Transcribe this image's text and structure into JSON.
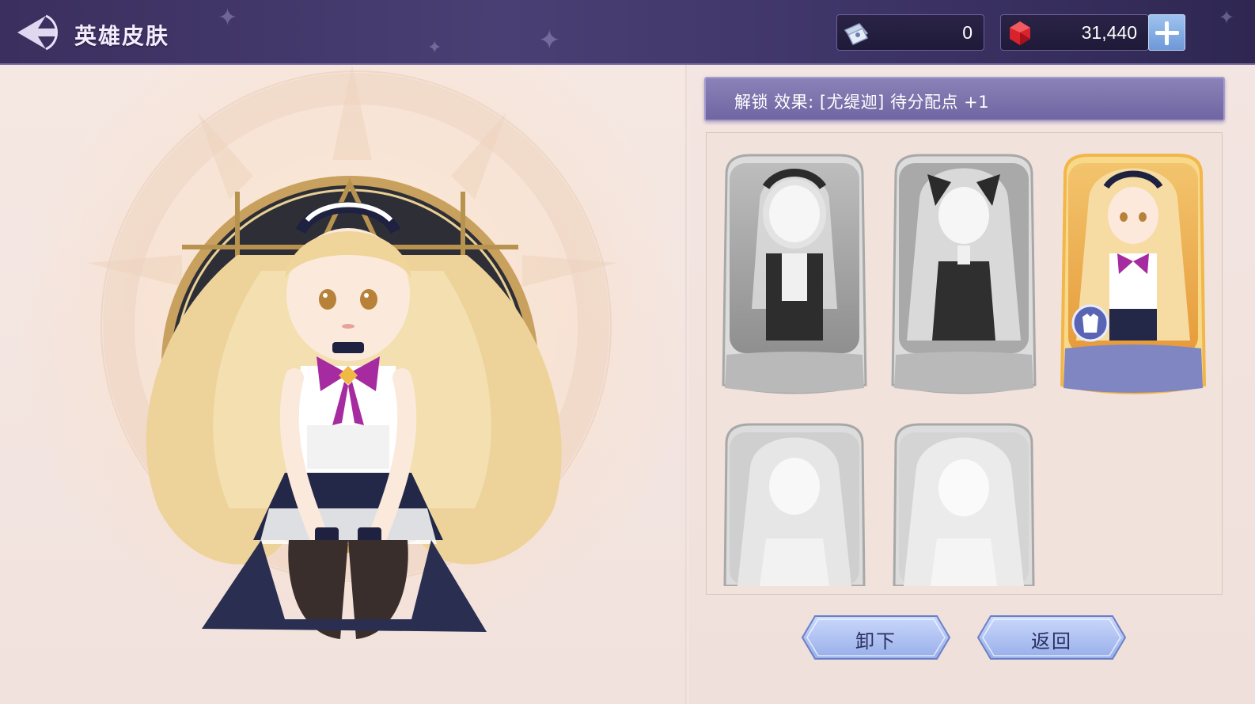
{
  "header": {
    "title": "英雄皮肤",
    "currencies": [
      {
        "icon": "ticket-icon",
        "value": "0"
      },
      {
        "icon": "red-gem-icon",
        "value": "31,440"
      }
    ]
  },
  "unlock": {
    "text": "解锁 效果: [尤缇迦] 待分配点 +1"
  },
  "skins": [
    {
      "state": "locked",
      "style": "maid-dark"
    },
    {
      "state": "locked",
      "style": "gothic-dress"
    },
    {
      "state": "equipped",
      "style": "maid-light",
      "badge": "outfit-icon"
    },
    {
      "state": "locked",
      "style": "white-dress"
    },
    {
      "state": "locked",
      "style": "bridal"
    }
  ],
  "buttons": {
    "unequip": "卸下",
    "back": "返回"
  },
  "colors": {
    "accent_purple": "#6f66a2",
    "gold": "#e9a94a",
    "button_blue": "#a9bff0"
  }
}
